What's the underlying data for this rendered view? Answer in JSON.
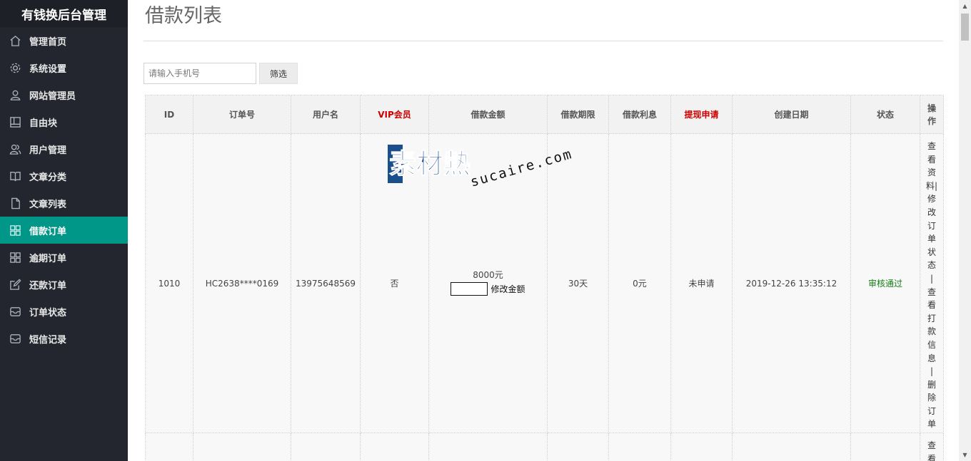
{
  "app": {
    "title": "有钱换后台管理"
  },
  "sidebar": {
    "items": [
      {
        "label": "管理首页",
        "icon": "home-icon"
      },
      {
        "label": "系统设置",
        "icon": "gear-icon"
      },
      {
        "label": "网站管理员",
        "icon": "user-icon"
      },
      {
        "label": "自由块",
        "icon": "template-icon"
      },
      {
        "label": "用户管理",
        "icon": "users-icon"
      },
      {
        "label": "文章分类",
        "icon": "book-icon"
      },
      {
        "label": "文章列表",
        "icon": "file-icon"
      },
      {
        "label": "借款订单",
        "icon": "grid-icon",
        "active": true
      },
      {
        "label": "逾期订单",
        "icon": "grid-icon"
      },
      {
        "label": "还款订单",
        "icon": "edit-icon"
      },
      {
        "label": "订单状态",
        "icon": "inbox-icon"
      },
      {
        "label": "短信记录",
        "icon": "inbox-icon"
      }
    ]
  },
  "main": {
    "title": "借款列表",
    "search": {
      "placeholder": "请输入手机号",
      "value": ""
    },
    "filter_label": "筛选"
  },
  "table": {
    "headers": {
      "id": "ID",
      "order_no": "订单号",
      "username": "用户名",
      "vip": "VIP会员",
      "amount": "借款金额",
      "term": "借款期限",
      "interest": "借款利息",
      "withdraw": "提现申请",
      "created": "创建日期",
      "status": "状态",
      "ops": "操作"
    },
    "rows": [
      {
        "id": "1010",
        "order_no": "HC2638****0169",
        "username": "13975648569",
        "vip": "否",
        "amount": "8000元",
        "amount_edit_label": "修改金额",
        "term": "30天",
        "interest": "0元",
        "withdraw": "未申请",
        "created": "2019-12-26 13:35:12",
        "status": "审核通过",
        "ops": [
          "查",
          "看",
          "资",
          "料|",
          "修",
          "改",
          "订",
          "单",
          "状",
          "态",
          "|",
          "查",
          "看",
          "打",
          "款",
          "信",
          "息",
          "|",
          "删",
          "除",
          "订",
          "单"
        ]
      },
      {
        "ops": [
          "查",
          "看"
        ]
      }
    ]
  },
  "watermark": {
    "mark": "素材熱",
    "domain": "sucaire.com"
  },
  "colors": {
    "accent": "#009688",
    "sidebar": "#23262e",
    "red": "#cc0000",
    "green": "#177c17"
  }
}
